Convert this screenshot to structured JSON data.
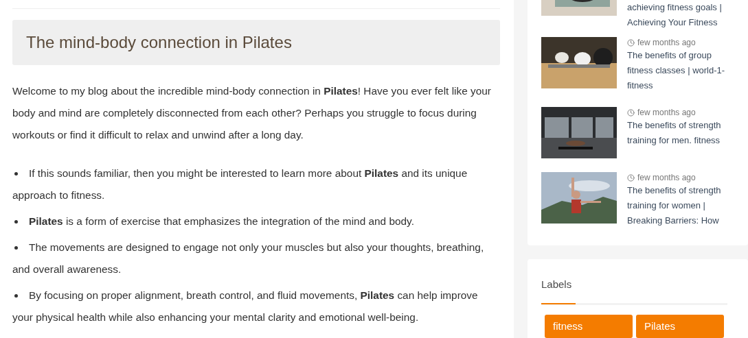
{
  "article": {
    "title": "The mind-body connection in Pilates",
    "intro": "Welcome to my blog about the incredible mind-body connection in **Pilates**! Have you ever felt like your body and mind are completely disconnected from each other? Perhaps you struggle to focus during workouts or find it difficult to relax and unwind after a long day.",
    "bullets": [
      "If this sounds familiar, then you might be interested to learn more about **Pilates** and its unique approach to fitness.",
      "**Pilates** is a form of exercise that emphasizes the integration of the mind and body.",
      "The movements are designed to engage not only your muscles but also your thoughts, breathing, and overall awareness.",
      "By focusing on proper alignment, breath control, and fluid movements, **Pilates** can help improve your physical health while also enhancing your mental clarity and emotional well-being."
    ]
  },
  "sidebar": {
    "posts": [
      {
        "kind": "picture",
        "title_lines": [
          "achieving fitness goals |",
          "Achieving Your Fitness"
        ]
      },
      {
        "kind": "picture",
        "time": "few months ago",
        "title_lines": [
          "The benefits of group",
          "fitness classes | world-1-",
          "fitness"
        ]
      },
      {
        "kind": "picture",
        "time": "few months ago",
        "title_lines": [
          "The benefits of strength",
          "training for men. fitness"
        ]
      },
      {
        "kind": "picture",
        "time": "few months ago",
        "title_lines": [
          "The benefits of strength",
          "training for women |",
          "Breaking Barriers: How"
        ]
      }
    ],
    "labels": {
      "title": "Labels",
      "tags": [
        "fitness",
        "Pilates"
      ]
    }
  }
}
